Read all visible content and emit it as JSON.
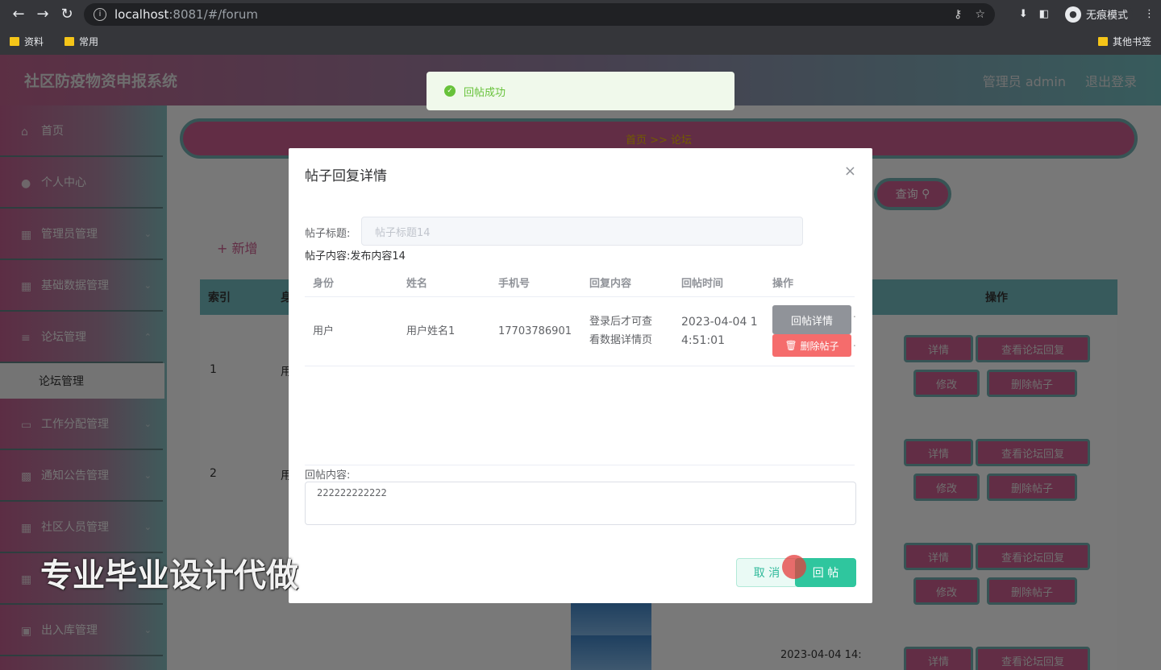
{
  "browser": {
    "url_host": "localhost",
    "url_path": ":8081/#/forum",
    "incognito_label": "无痕模式",
    "bookmarks": [
      "资料",
      "常用"
    ],
    "other_bookmarks": "其他书签"
  },
  "header": {
    "title": "社区防疫物资申报系统",
    "user": "管理员 admin",
    "logout": "退出登录"
  },
  "sidebar": {
    "items": [
      {
        "label": "首页"
      },
      {
        "label": "个人中心"
      },
      {
        "label": "管理员管理"
      },
      {
        "label": "基础数据管理"
      },
      {
        "label": "论坛管理"
      },
      {
        "label": "工作分配管理"
      },
      {
        "label": "通知公告管理"
      },
      {
        "label": "社区人员管理"
      },
      {
        "label": ""
      },
      {
        "label": "出入库管理"
      }
    ],
    "submenu_active": "论坛管理"
  },
  "main": {
    "breadcrumb": "首页 >> 论坛",
    "search_label": "查询",
    "add_label": "+ 新增",
    "table_headers": {
      "index": "索引",
      "col2": "身",
      "ops": "操作"
    },
    "rows": [
      {
        "index": "1",
        "col2": "用"
      },
      {
        "index": "2",
        "col2": "用"
      },
      {
        "index": "3",
        "col2": ""
      }
    ],
    "row_buttons": {
      "detail": "详情",
      "view_reply": "查看论坛回复",
      "edit": "修改",
      "delete": "删除帖子"
    },
    "partial_date": "2023-04-04 14:"
  },
  "toast": {
    "message": "回帖成功"
  },
  "dialog": {
    "title": "帖子回复详情",
    "post_title_label": "帖子标题:",
    "post_title_value": "帖子标题14",
    "post_content_label": "帖子内容:",
    "post_content_value": "发布内容14",
    "table": {
      "headers": [
        "身份",
        "姓名",
        "手机号",
        "回复内容",
        "回帖时间",
        "操作"
      ],
      "rows": [
        {
          "identity": "用户",
          "name": "用户姓名1",
          "phone": "17703786901",
          "content_line1": "登录后才可查",
          "content_line2": "看数据详情页",
          "time_line1": "2023-04-04 1",
          "time_line2": "4:51:01",
          "detail_btn": "回帖详情",
          "delete_btn": "删除帖子"
        }
      ]
    },
    "reply_label": "回帖内容:",
    "reply_value": "222222222222",
    "cancel": "取 消",
    "submit": "回 帖"
  },
  "watermark": "专业毕业设计代做",
  "colors": {
    "accent_pink": "#c55b8a",
    "accent_teal": "#6fb5b8",
    "success": "#67c23a",
    "submit_green": "#2fc69e",
    "danger": "#f56c6c"
  }
}
